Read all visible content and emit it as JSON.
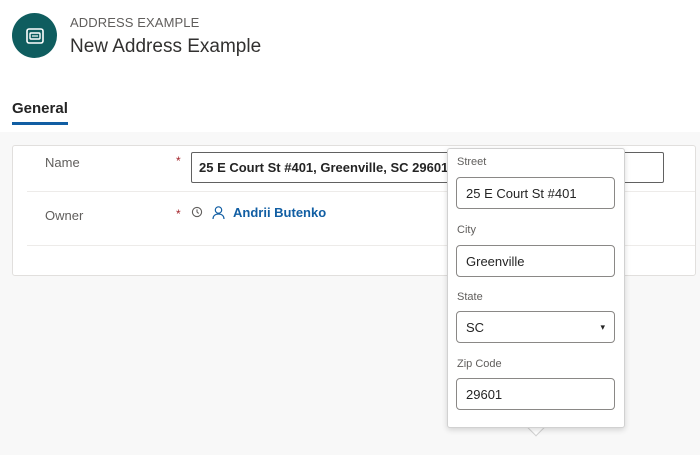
{
  "header": {
    "entity_type": "ADDRESS EXAMPLE",
    "record_title": "New Address Example",
    "icon": "address-card-icon"
  },
  "tabs": [
    {
      "label": "General",
      "selected": true
    }
  ],
  "form": {
    "name": {
      "label": "Name",
      "required_mark": "*",
      "value": "25 E Court St #401, Greenville, SC 29601"
    },
    "owner": {
      "label": "Owner",
      "required_mark": "*",
      "value": "Andrii Butenko",
      "icons": [
        "lock-icon",
        "person-icon"
      ]
    }
  },
  "address_flyout": {
    "street": {
      "label": "Street",
      "value": "25 E Court St #401"
    },
    "city": {
      "label": "City",
      "value": "Greenville"
    },
    "state": {
      "label": "State",
      "value": "SC",
      "caret": "▾"
    },
    "zip": {
      "label": "Zip Code",
      "value": "29601"
    }
  },
  "colors": {
    "entity_icon_bg": "#0f5d5f",
    "tab_underline": "#115ea3",
    "link": "#115ea3",
    "required": "#a4262c"
  }
}
